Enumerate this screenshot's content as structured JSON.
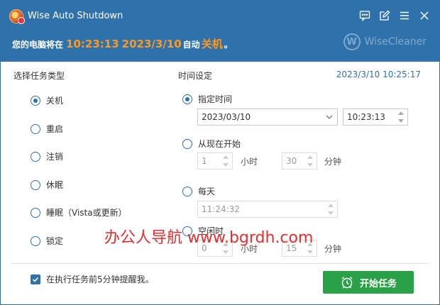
{
  "titlebar": {
    "title": "Wise Auto Shutdown",
    "icons": [
      "feedback-icon",
      "edit-icon",
      "menu-icon",
      "close-icon"
    ]
  },
  "status": {
    "prefix": "您的电脑将在",
    "time": "10:23:13",
    "date": "2023/3/10",
    "middle": "自动",
    "action": "关机",
    "suffix": "。"
  },
  "brand": {
    "logo_letter": "W",
    "name": "WiseCleaner"
  },
  "left": {
    "title": "选择任务类型",
    "tasks": [
      {
        "label": "关机",
        "checked": true
      },
      {
        "label": "重启",
        "checked": false
      },
      {
        "label": "注销",
        "checked": false
      },
      {
        "label": "休眠",
        "checked": false
      },
      {
        "label": "睡眠（Vista或更新）",
        "checked": false
      },
      {
        "label": "锁定",
        "checked": false
      }
    ]
  },
  "right": {
    "title": "时间设定",
    "current_time": "2023/3/10 10:25:17",
    "specified": {
      "label": "指定时间",
      "date": "2023/03/10",
      "time": "10:23:13"
    },
    "from_now": {
      "label": "从现在开始",
      "hours": "1",
      "hour_unit": "小时",
      "minutes": "30",
      "minute_unit": "分钟"
    },
    "daily": {
      "label": "每天",
      "time": "11:24:32"
    },
    "idle": {
      "label": "空闲时",
      "hours": "0",
      "hour_unit": "小时",
      "minutes": "15",
      "minute_unit": "分钟"
    }
  },
  "footer": {
    "remind_label": "在执行任务前5分钟提醒我。",
    "start_label": "开始任务"
  },
  "watermark": "办公人导航 www.bgrdh.com",
  "colors": {
    "header": "#2f72ab",
    "accent": "#ff9a1f",
    "start": "#2aa146"
  }
}
